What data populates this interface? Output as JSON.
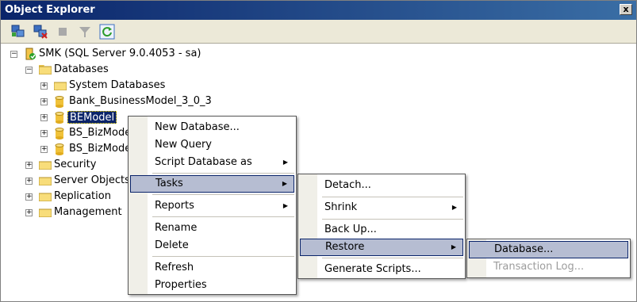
{
  "window": {
    "title": "Object Explorer",
    "close_glyph": "x"
  },
  "toolbar": {
    "buttons": [
      {
        "icon": "connect-icon"
      },
      {
        "icon": "disconnect-icon"
      },
      {
        "icon": "stop-icon"
      },
      {
        "icon": "filter-icon"
      },
      {
        "icon": "refresh-icon"
      }
    ]
  },
  "tree": {
    "server": {
      "label": "SMK (SQL Server 9.0.4053 - sa)",
      "expander": "−"
    },
    "databases": {
      "label": "Databases",
      "expander": "−"
    },
    "db_children": [
      {
        "label": "System Databases",
        "type": "folder"
      },
      {
        "label": "Bank_BusinessModel_3_0_3",
        "type": "db"
      },
      {
        "label": "BEModel",
        "type": "db",
        "selected": true
      },
      {
        "label": "BS_BizMode",
        "type": "db"
      },
      {
        "label": "BS_BizMode",
        "type": "db"
      }
    ],
    "folders": [
      {
        "label": "Security"
      },
      {
        "label": "Server Objects"
      },
      {
        "label": "Replication"
      },
      {
        "label": "Management"
      }
    ],
    "plus": "+"
  },
  "context_menu": {
    "items": [
      {
        "label": "New Database...",
        "arrow": ""
      },
      {
        "label": "New Query",
        "arrow": ""
      },
      {
        "label": "Script Database as",
        "arrow": "▶"
      },
      {
        "label": "Tasks",
        "arrow": "▶"
      },
      {
        "label": "Reports",
        "arrow": "▶"
      },
      {
        "label": "Rename",
        "arrow": ""
      },
      {
        "label": "Delete",
        "arrow": ""
      },
      {
        "label": "Refresh",
        "arrow": ""
      },
      {
        "label": "Properties",
        "arrow": ""
      }
    ]
  },
  "tasks_menu": {
    "items": [
      {
        "label": "Detach...",
        "arrow": ""
      },
      {
        "label": "Shrink",
        "arrow": "▶"
      },
      {
        "label": "Back Up...",
        "arrow": ""
      },
      {
        "label": "Restore",
        "arrow": "▶"
      },
      {
        "label": "Generate Scripts...",
        "arrow": ""
      }
    ]
  },
  "restore_menu": {
    "items": [
      {
        "label": "Database...",
        "disabled": false
      },
      {
        "label": "Transaction Log...",
        "disabled": true
      }
    ]
  },
  "colors": {
    "titlebar_start": "#0a246a",
    "titlebar_end": "#3a6ea5",
    "highlight": "#b6bdd2",
    "selection": "#0a246a"
  }
}
